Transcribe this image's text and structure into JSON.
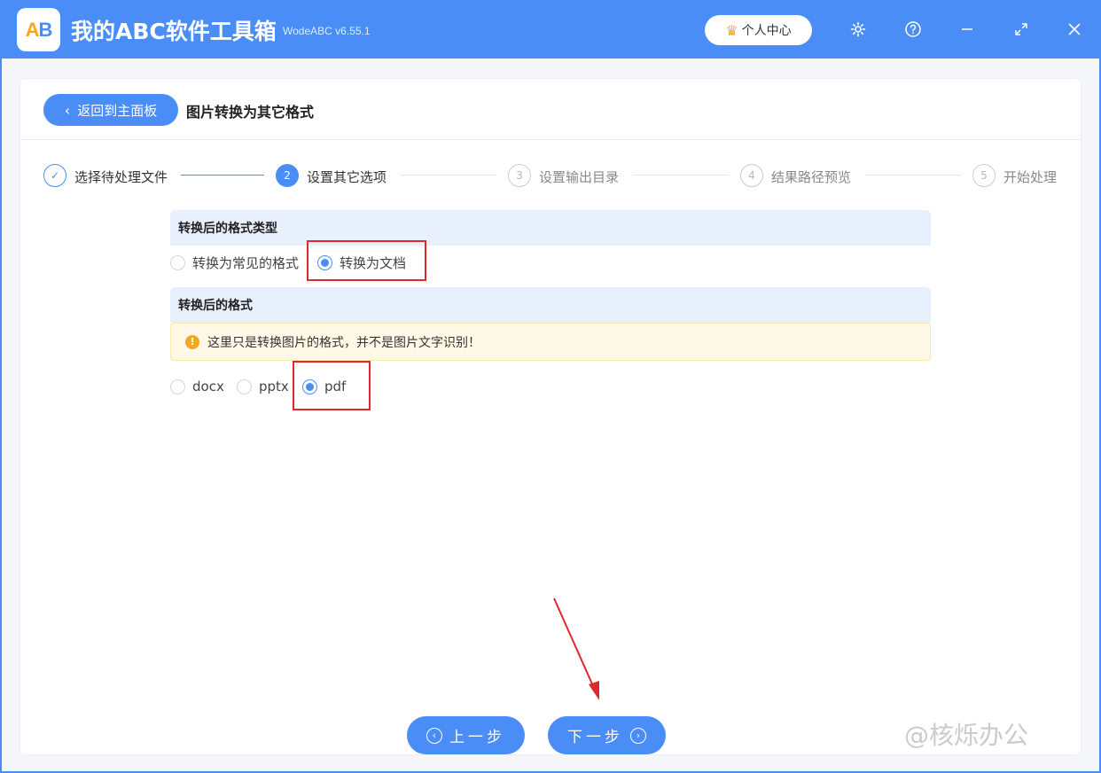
{
  "app": {
    "logo_text_a": "A",
    "logo_text_b": "B",
    "title": "我的ABC软件工具箱",
    "version": "WodeABC v6.55.1",
    "user_center": "个人中心"
  },
  "header": {
    "back_label": "返回到主面板",
    "page_title": "图片转换为其它格式"
  },
  "steps": [
    {
      "num": "✓",
      "label": "选择待处理文件",
      "state": "done"
    },
    {
      "num": "2",
      "label": "设置其它选项",
      "state": "active"
    },
    {
      "num": "3",
      "label": "设置输出目录",
      "state": "todo"
    },
    {
      "num": "4",
      "label": "结果路径预览",
      "state": "todo"
    },
    {
      "num": "5",
      "label": "开始处理",
      "state": "todo"
    }
  ],
  "format_type": {
    "heading": "转换后的格式类型",
    "options": [
      {
        "label": "转换为常见的格式",
        "checked": false
      },
      {
        "label": "转换为文档",
        "checked": true
      }
    ]
  },
  "format": {
    "heading": "转换后的格式",
    "notice": "这里只是转换图片的格式，并不是图片文字识别！",
    "options": [
      {
        "label": "docx",
        "checked": false
      },
      {
        "label": "pptx",
        "checked": false
      },
      {
        "label": "pdf",
        "checked": true
      }
    ]
  },
  "footer": {
    "prev_label": "上一步",
    "next_label": "下一步"
  },
  "watermark": "@核烁办公",
  "colors": {
    "accent": "#4a8df6",
    "highlight": "#e0282c",
    "notice_bg": "#fef8e6",
    "warning": "#f5a623"
  },
  "icons": [
    "crown-icon",
    "gear-icon",
    "help-icon",
    "minimize-icon",
    "maximize-icon",
    "close-icon",
    "chevron-left-icon",
    "warning-icon",
    "arrow-left-circle-icon",
    "arrow-right-circle-icon"
  ]
}
